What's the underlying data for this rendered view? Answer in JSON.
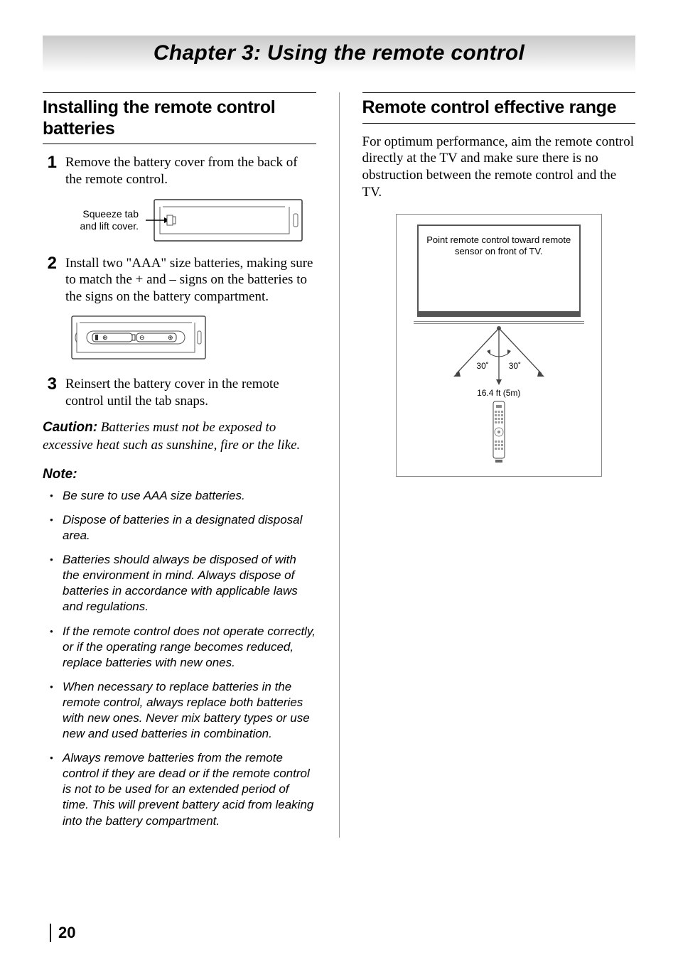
{
  "chapter_title": "Chapter 3: Using the remote control",
  "page_number": "20",
  "left": {
    "heading": "Installing the remote control batteries",
    "steps": [
      {
        "num": "1",
        "text": "Remove the battery cover from the back of the remote control."
      },
      {
        "num": "2",
        "text": "Install two \"AAA\" size batteries, making sure to match the + and – signs on the batteries to the signs on the battery compartment."
      },
      {
        "num": "3",
        "text": "Reinsert the battery cover in the remote control until the tab snaps."
      }
    ],
    "fig1_label_line1": "Squeeze tab",
    "fig1_label_line2": "and lift cover.",
    "caution_label": "Caution:",
    "caution_text": " Batteries must not be exposed to excessive heat such as sunshine, fire or the like.",
    "note_heading": "Note:",
    "notes": [
      "Be sure to use AAA size batteries.",
      "Dispose of batteries in a designated disposal area.",
      "Batteries should always be disposed of with the environment in mind. Always dispose of batteries in accordance with applicable laws and regulations.",
      "If the remote control does not operate correctly, or if the operating range becomes reduced, replace batteries with new ones.",
      "When necessary to replace batteries in the remote control, always replace both batteries with new ones. Never mix battery types or use new and used batteries in combination.",
      "Always remove batteries from the remote control if they are dead or if the remote control is not to be used for an extended period of time. This will prevent battery acid from leaking into the battery compartment."
    ]
  },
  "right": {
    "heading": "Remote control effective range",
    "intro": "For optimum performance, aim the remote control directly at the TV and make sure there is no obstruction between the remote control and the TV.",
    "diagram": {
      "tv_text": "Point remote control toward remote sensor on front of TV.",
      "angle_left": "30˚",
      "angle_right": "30˚",
      "distance": "16.4 ft (5m)"
    }
  }
}
